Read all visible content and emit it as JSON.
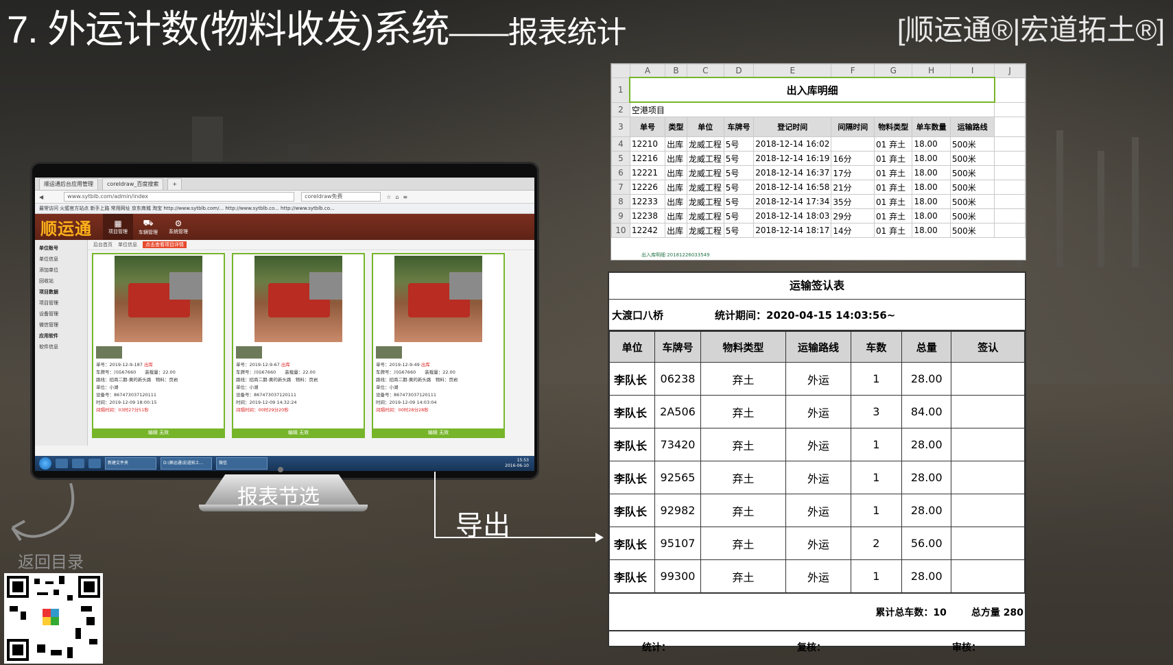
{
  "header": {
    "title": "7. 外运计数(物料收发)系统",
    "subtitle": "——报表统计",
    "brand": "[顺运通®|宏道拓土®]"
  },
  "monitor": {
    "tabs": [
      "顺运通后台应用管理",
      "coreldraw_百度搜索"
    ],
    "url": "www.sytblb.com/admin/index",
    "search": "coreldraw免费",
    "bookmarks": "最常访问  火狐官方站点  新手上路  常用网址  京东商城  淘宝  http://www.sytblb.com/...  http://www.sytblb.co...  http://www.sytblb.co...",
    "app_logo": "顺运通",
    "nav": [
      {
        "label": "项目管理",
        "icon": "▦"
      },
      {
        "label": "车辆管理",
        "icon": "⛟"
      },
      {
        "label": "系统管理",
        "icon": "⚙"
      }
    ],
    "sidebar": [
      {
        "label": "单位账号",
        "group": true
      },
      {
        "label": "单位信息",
        "group": false
      },
      {
        "label": "添加单位",
        "group": false
      },
      {
        "label": "回收站",
        "group": false
      },
      {
        "label": "项目数据",
        "group": true
      },
      {
        "label": "项目管理",
        "group": false
      },
      {
        "label": "设备管理",
        "group": false
      },
      {
        "label": "微信管理",
        "group": false
      },
      {
        "label": "应用软件",
        "group": true
      },
      {
        "label": "软件信息",
        "group": false
      }
    ],
    "breadcrumbs": [
      "后台首页",
      "单位信息",
      "点击查看项目详情"
    ],
    "cards": [
      {
        "no": "单号：2019-12-9-187",
        "dir": "出库",
        "plate": "车牌号：川G67660",
        "load": "装载量：22.00",
        "route": "路线：招商二期-黄的新头路",
        "material": "物料：页岩",
        "unit": "单位：小湖",
        "device": "设备号：867473037120111",
        "time": "时间：2019-12-09 18:00:15",
        "gap": "间隔时间：03时27分51秒",
        "actions": "编辑  无效"
      },
      {
        "no": "单号：2019-12-9-67",
        "dir": "出库",
        "plate": "车牌号：川G67660",
        "load": "装载量：22.00",
        "route": "路线：招商二期-黄的新头路",
        "material": "物料：页岩",
        "unit": "单位：小湖",
        "device": "设备号：867473037120111",
        "time": "时间：2019-12-09 14:32:24",
        "gap": "间隔时间：00时29分20秒",
        "actions": "编辑  无效"
      },
      {
        "no": "单号：2019-12-9-49",
        "dir": "出库",
        "plate": "车牌号：川G67660",
        "load": "装载量：22.00",
        "route": "路线：招商二期-黄的新头路",
        "material": "物料：页岩",
        "unit": "单位：小湖",
        "device": "设备号：867473037120111",
        "time": "时间：2019-12-09 14:03:04",
        "gap": "间隔时间：00时28分28秒",
        "actions": "编辑  无效"
      }
    ],
    "taskbar": [
      "新建文件夹",
      "D:\\顺运通\\宏道拓土...",
      "微信"
    ],
    "clock": "15:53\n2016-06-10",
    "stand_label": "报表节选"
  },
  "export_label": "导出",
  "back_label": "返回目录",
  "spreadsheet": {
    "columns": [
      "A",
      "B",
      "C",
      "D",
      "E",
      "F",
      "G",
      "H",
      "I",
      "J"
    ],
    "title": "出入库明细",
    "project": "空港项目",
    "headers": [
      "单号",
      "类型",
      "单位",
      "车牌号",
      "登记时间",
      "间隔时间",
      "物料类型",
      "单车数量",
      "运输路线"
    ],
    "rows": [
      [
        "12210",
        "出库",
        "龙威工程",
        "5号",
        "2018-12-14 16:02",
        "",
        "01 弃土",
        "18.00",
        "500米"
      ],
      [
        "12216",
        "出库",
        "龙威工程",
        "5号",
        "2018-12-14 16:19",
        "16分",
        "01 弃土",
        "18.00",
        "500米"
      ],
      [
        "12221",
        "出库",
        "龙威工程",
        "5号",
        "2018-12-14 16:37",
        "17分",
        "01 弃土",
        "18.00",
        "500米"
      ],
      [
        "12226",
        "出库",
        "龙威工程",
        "5号",
        "2018-12-14 16:58",
        "21分",
        "01 弃土",
        "18.00",
        "500米"
      ],
      [
        "12233",
        "出库",
        "龙威工程",
        "5号",
        "2018-12-14 17:34",
        "35分",
        "01 弃土",
        "18.00",
        "500米"
      ],
      [
        "12238",
        "出库",
        "龙威工程",
        "5号",
        "2018-12-14 18:03",
        "29分",
        "01 弃土",
        "18.00",
        "500米"
      ],
      [
        "12242",
        "出库",
        "龙威工程",
        "5号",
        "2018-12-14 18:17",
        "14分",
        "01 弃土",
        "18.00",
        "500米"
      ]
    ],
    "sheet_tab": "出入库明细 20181226033549"
  },
  "confirm_form": {
    "title": "运输签认表",
    "site": "大渡口八桥",
    "period": "统计期间：2020-04-15 14:03:56~",
    "headers": [
      "单位",
      "车牌号",
      "物料类型",
      "运输路线",
      "车数",
      "总量",
      "签认"
    ],
    "rows": [
      [
        "李队长",
        "06238",
        "弃土",
        "外运",
        "1",
        "28.00",
        ""
      ],
      [
        "李队长",
        "2A506",
        "弃土",
        "外运",
        "3",
        "84.00",
        ""
      ],
      [
        "李队长",
        "73420",
        "弃土",
        "外运",
        "1",
        "28.00",
        ""
      ],
      [
        "李队长",
        "92565",
        "弃土",
        "外运",
        "1",
        "28.00",
        ""
      ],
      [
        "李队长",
        "92982",
        "弃土",
        "外运",
        "1",
        "28.00",
        ""
      ],
      [
        "李队长",
        "95107",
        "弃土",
        "外运",
        "2",
        "56.00",
        ""
      ],
      [
        "李队长",
        "99300",
        "弃土",
        "外运",
        "1",
        "28.00",
        ""
      ]
    ],
    "total_trucks": "累计总车数：10",
    "total_volume": "总方量 280",
    "sign_stat": "统计：",
    "sign_review": "复核：",
    "sign_audit": "审核："
  }
}
